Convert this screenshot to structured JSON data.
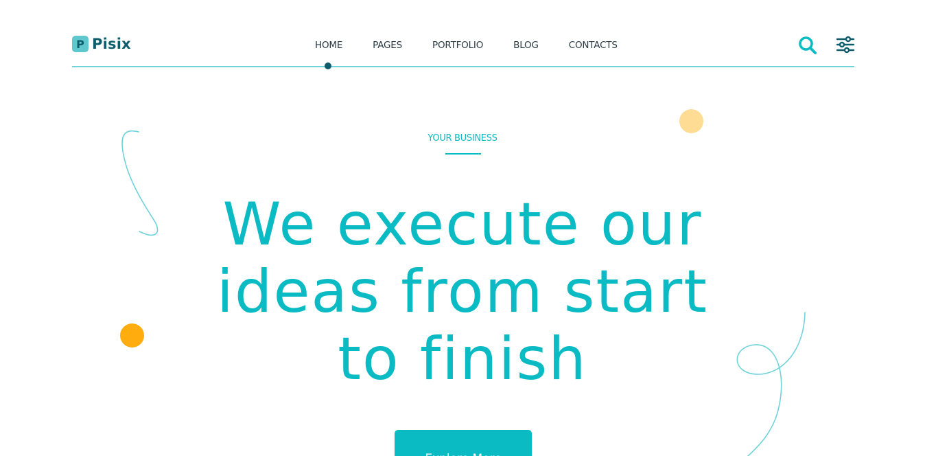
{
  "brand": {
    "logo_letter": "P",
    "name": "Pisix"
  },
  "nav": {
    "items": [
      {
        "label": "HOME",
        "active": true
      },
      {
        "label": "PAGES",
        "active": false
      },
      {
        "label": "PORTFOLIO",
        "active": false
      },
      {
        "label": "BLOG",
        "active": false
      },
      {
        "label": "CONTACTS",
        "active": false
      }
    ]
  },
  "header_icons": [
    "search-icon",
    "settings-sliders-icon"
  ],
  "hero": {
    "eyebrow": "YOUR BUSINESS",
    "headline_lines": [
      "We execute our",
      "ideas from start",
      "to finish"
    ],
    "cta_label": "Explore More"
  },
  "colors": {
    "accent": "#0bbbc4",
    "dark": "#0e5d6c",
    "peach": "#ffdc94",
    "orange": "#ffad0e",
    "line": "#6fd3da"
  }
}
